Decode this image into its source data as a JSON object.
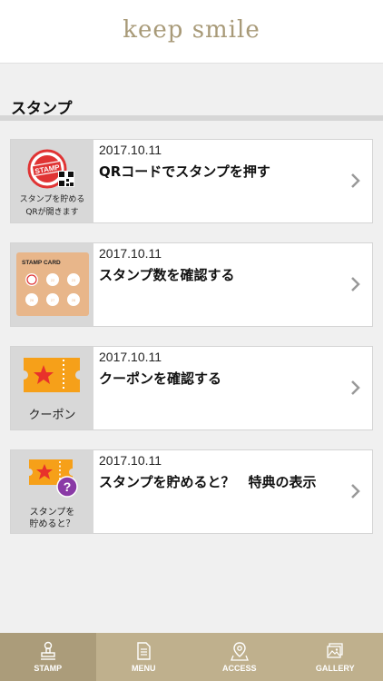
{
  "header": {
    "logo_text": "keep smile"
  },
  "section": {
    "title": "スタンプ"
  },
  "cards": [
    {
      "date": "2017.10.11",
      "title": "QRコードでスタンプを押す",
      "thumb_caption_1": "スタンプを貯める",
      "thumb_caption_2": "QRが開きます",
      "thumb_icon_text": "STAMP"
    },
    {
      "date": "2017.10.11",
      "title": "スタンプ数を確認する",
      "thumb_icon_text": "STAMP CARD",
      "stamp_slot_labels": [
        "22",
        "23",
        "26",
        "27",
        "28"
      ]
    },
    {
      "date": "2017.10.11",
      "title": "クーポンを確認する",
      "thumb_caption_1": "クーポン"
    },
    {
      "date": "2017.10.11",
      "title": "スタンプを貯めると？　特典の表示",
      "thumb_caption_1": "スタンプを",
      "thumb_caption_2": "貯めると？"
    }
  ],
  "tabbar": {
    "items": [
      {
        "label": "STAMP",
        "icon": "stamp-icon",
        "active": true
      },
      {
        "label": "MENU",
        "icon": "menu-document-icon",
        "active": false
      },
      {
        "label": "ACCESS",
        "icon": "map-pin-icon",
        "active": false
      },
      {
        "label": "GALLERY",
        "icon": "gallery-image-icon",
        "active": false
      }
    ]
  },
  "colors": {
    "tabbar": "#bfb08d",
    "tab_active": "#ab9c7a",
    "logo": "#a89a78",
    "stamp_red": "#e03434",
    "coupon_orange": "#f6a019",
    "star_red": "#e8322b",
    "purple_badge": "#8a3aa6",
    "stamp_card_tan": "#e8b68a"
  }
}
